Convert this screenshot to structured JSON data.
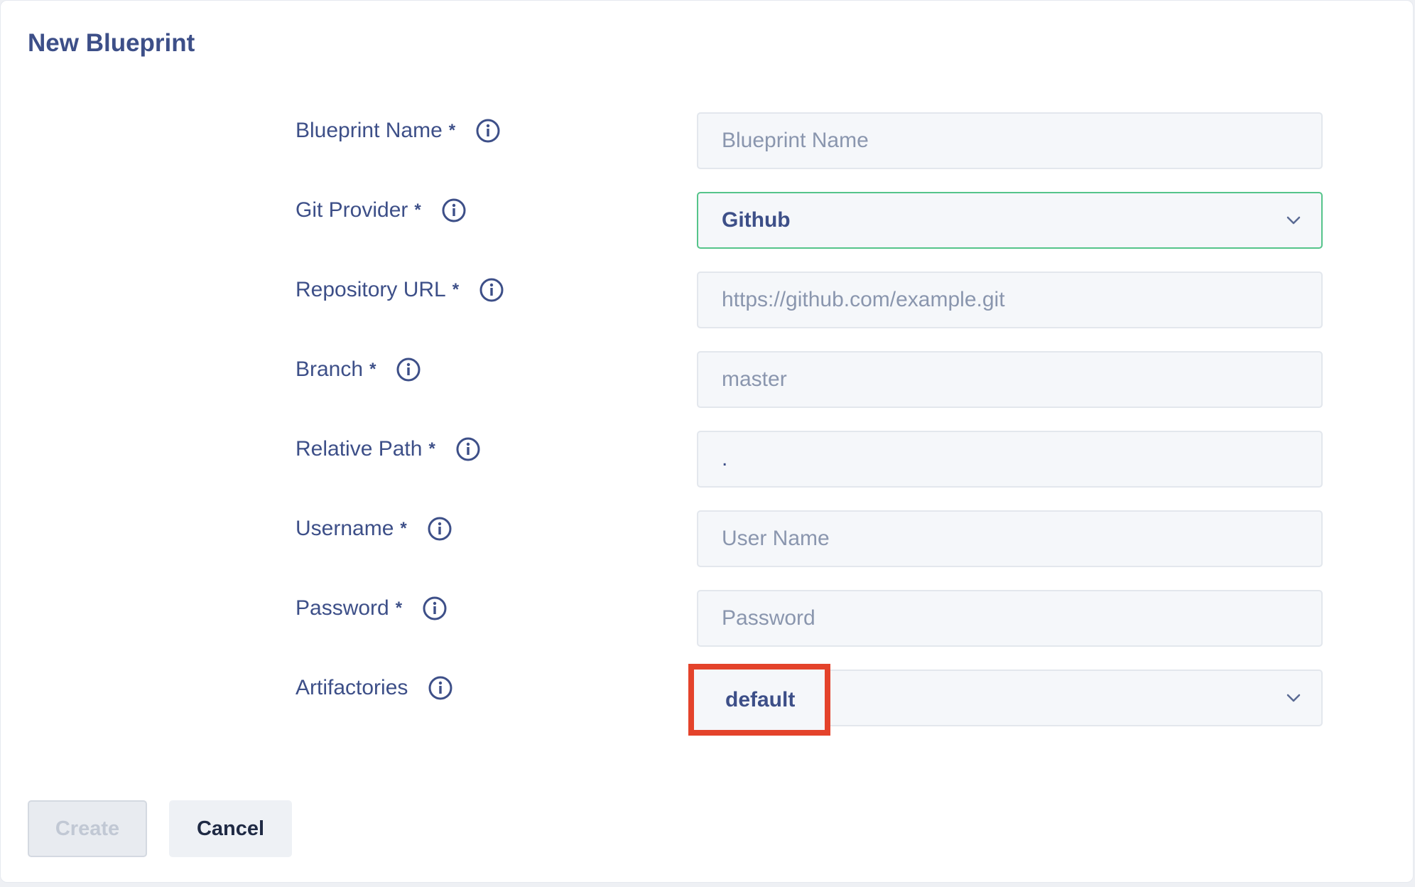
{
  "page": {
    "title": "New Blueprint"
  },
  "form": {
    "blueprint_name": {
      "label": "Blueprint Name",
      "required": "*",
      "placeholder": "Blueprint Name"
    },
    "git_provider": {
      "label": "Git Provider",
      "required": "*",
      "value": "Github"
    },
    "repository_url": {
      "label": "Repository URL",
      "required": "*",
      "placeholder": "https://github.com/example.git"
    },
    "branch": {
      "label": "Branch",
      "required": "*",
      "placeholder": "master"
    },
    "relative_path": {
      "label": "Relative Path",
      "required": "*",
      "value": "."
    },
    "username": {
      "label": "Username",
      "required": "*",
      "placeholder": "User Name"
    },
    "password": {
      "label": "Password",
      "required": "*",
      "placeholder": "Password"
    },
    "artifactories": {
      "label": "Artifactories",
      "value": "default"
    }
  },
  "buttons": {
    "create": "Create",
    "cancel": "Cancel"
  },
  "colors": {
    "accent": "#3d4f88",
    "active_border": "#55c48a",
    "highlight": "#e4432b"
  },
  "icons": {
    "info": "info-circle-icon",
    "chevron": "chevron-down-icon"
  }
}
